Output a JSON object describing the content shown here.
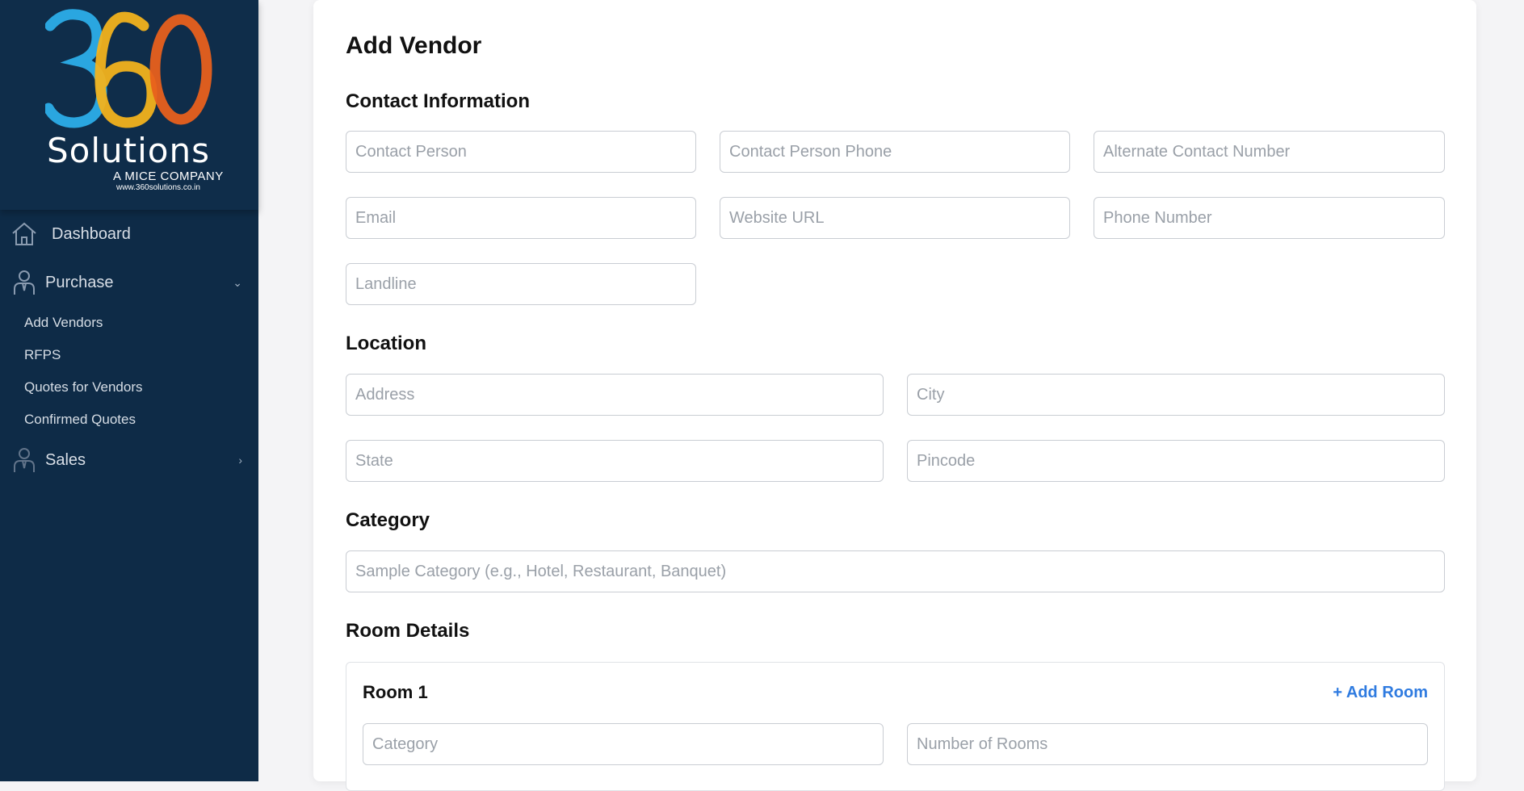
{
  "sidebar": {
    "logo": {
      "digits": "360",
      "name": "Solutions",
      "tagline": "A MICE COMPANY",
      "url": "www.360solutions.co.in",
      "colors": {
        "three": "#2aa6e0",
        "six": "#f2b21c",
        "zero": "#e8601c"
      }
    },
    "items": [
      {
        "label": "Dashboard",
        "icon": "home-icon"
      },
      {
        "label": "Purchase",
        "icon": "user-tie-icon",
        "expanded": true,
        "children": [
          "Add Vendors",
          "RFPS",
          "Quotes for Vendors",
          "Confirmed Quotes"
        ]
      },
      {
        "label": "Sales",
        "icon": "user-tie-icon",
        "expanded": false
      }
    ]
  },
  "main": {
    "title": "Add Vendor",
    "sections": {
      "contact": {
        "title": "Contact Information",
        "placeholders": {
          "contact_person": "Contact Person",
          "contact_person_phone": "Contact Person Phone",
          "alternate_contact": "Alternate Contact Number",
          "email": "Email",
          "website": "Website URL",
          "phone": "Phone Number",
          "landline": "Landline"
        }
      },
      "location": {
        "title": "Location",
        "placeholders": {
          "address": "Address",
          "city": "City",
          "state": "State",
          "pincode": "Pincode"
        }
      },
      "category": {
        "title": "Category",
        "placeholder": "Sample Category (e.g., Hotel, Restaurant, Banquet)"
      },
      "rooms": {
        "title": "Room Details",
        "room_title": "Room 1",
        "add_room": "+ Add Room",
        "placeholders": {
          "category": "Category",
          "number": "Number of Rooms"
        }
      }
    }
  },
  "colors": {
    "sidebar": "#0e2b47",
    "accent": "#2f7be0"
  }
}
